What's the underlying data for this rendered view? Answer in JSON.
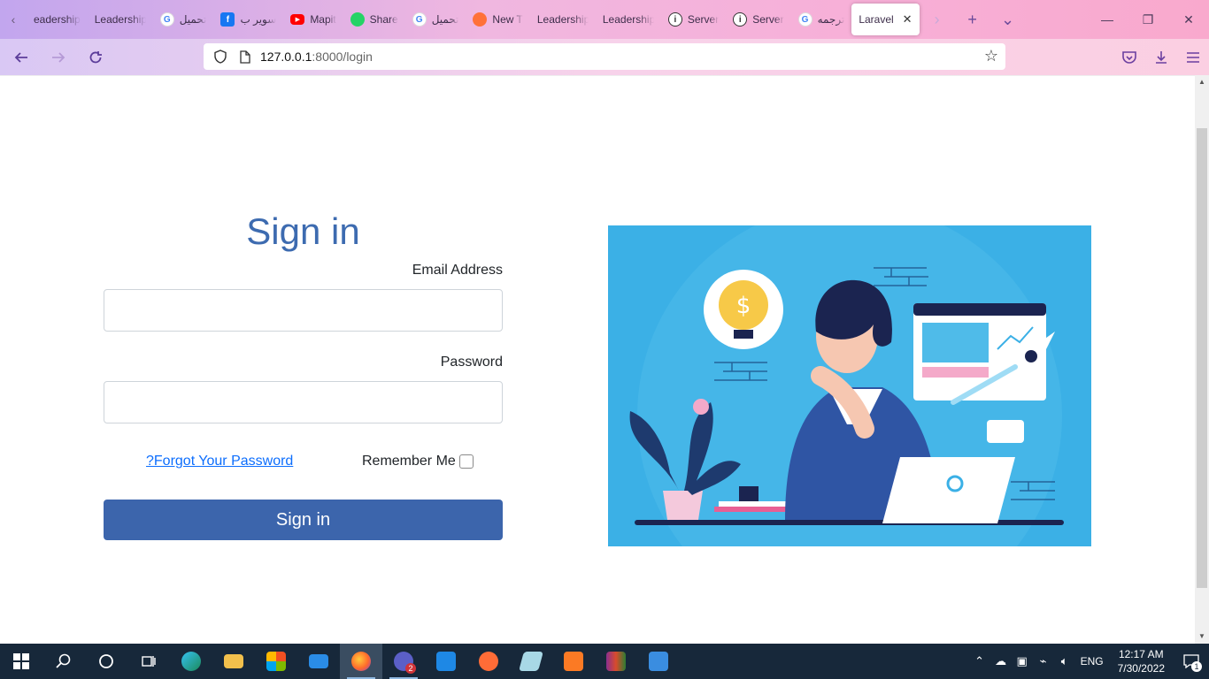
{
  "browser": {
    "tabs": [
      {
        "label": "eadership",
        "favicon": "none"
      },
      {
        "label": "Leadership",
        "favicon": "none"
      },
      {
        "label": "تحميل",
        "favicon": "google-icon"
      },
      {
        "label": "سوير ب",
        "favicon": "facebook-icon"
      },
      {
        "label": "Mapit",
        "favicon": "youtube-icon"
      },
      {
        "label": "Share",
        "favicon": "whatsapp-icon"
      },
      {
        "label": "تحميل",
        "favicon": "google-icon"
      },
      {
        "label": "New T",
        "favicon": "firefox-icon"
      },
      {
        "label": "Leadership",
        "favicon": "none"
      },
      {
        "label": "Leadership",
        "favicon": "none"
      },
      {
        "label": "Server",
        "favicon": "info-icon"
      },
      {
        "label": "Server",
        "favicon": "info-icon"
      },
      {
        "label": "ترجمه",
        "favicon": "google-icon"
      },
      {
        "label": "Laravel",
        "favicon": "none",
        "active": true
      }
    ],
    "url_host": "127.0.0.1",
    "url_path": ":8000/login"
  },
  "login": {
    "title": "Sign in",
    "email_label": "Email Address",
    "email_value": "",
    "password_label": "Password",
    "password_value": "",
    "forgot_label": "?Forgot Your Password",
    "remember_label": "Remember Me",
    "remember_checked": false,
    "submit_label": "Sign in"
  },
  "taskbar": {
    "apps": [
      "start",
      "search",
      "cortana",
      "task-view",
      "edge",
      "file-explorer",
      "store",
      "mail",
      "firefox",
      "teams",
      "vscode",
      "sublime",
      "notepad",
      "xampp",
      "winrar",
      "photos"
    ],
    "teams_badge": "2",
    "language": "ENG",
    "time": "12:17 AM",
    "date": "7/30/2022",
    "notification_count": "1"
  },
  "colors": {
    "accent": "#3c65ac",
    "title": "#3d6bb0",
    "illustration_bg": "#3bb0e6"
  }
}
